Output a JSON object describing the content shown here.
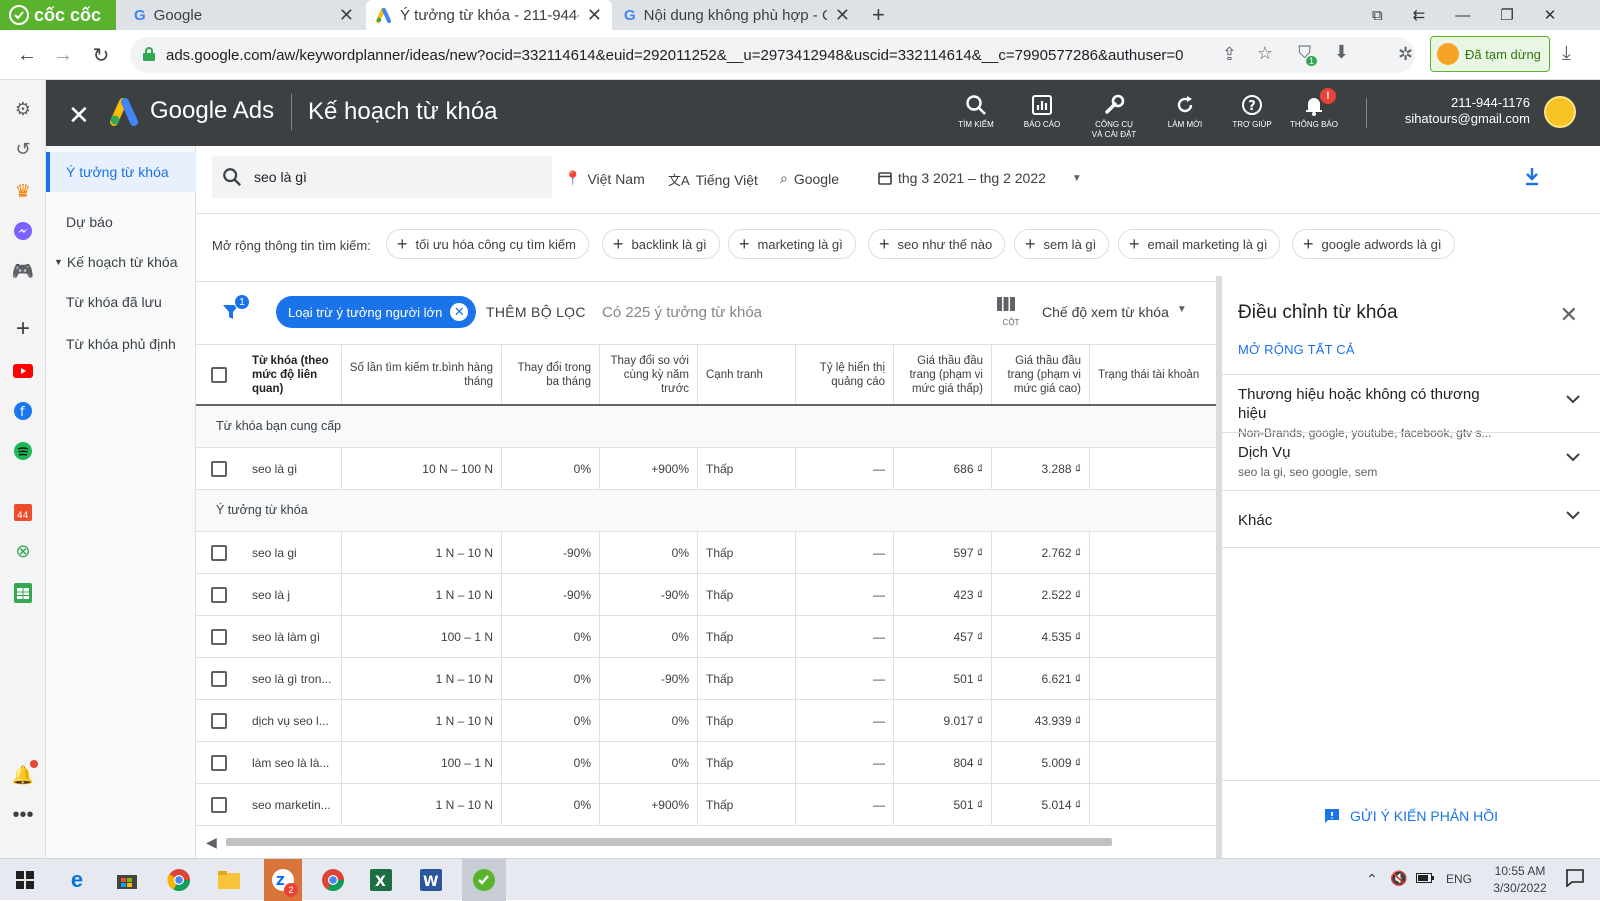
{
  "browser": {
    "brand": "cốc cốc",
    "tabs": [
      {
        "title": "Google",
        "icon": "google-icon"
      },
      {
        "title": "Ý tưởng từ khóa - 211-944-1",
        "icon": "google-ads-icon"
      },
      {
        "title": "Nội dung không phù hợp - C",
        "icon": "google-icon"
      }
    ],
    "url": "ads.google.com/aw/keywordplanner/ideas/new?ocid=332114614&euid=292011252&__u=2973412948&uscid=332114614&__c=7990577286&authuser=0",
    "paused_label": "Đã tạm dừng",
    "extension_badge": "1"
  },
  "header": {
    "brand": "Google Ads",
    "title": "Kế hoạch từ khóa",
    "tools": [
      {
        "label": "TÌM KIẾM",
        "icon": "search-icon"
      },
      {
        "label": "BÁO CÁO",
        "icon": "reports-icon"
      },
      {
        "label": "CÔNG CỤ VÀ CÀI ĐẶT",
        "icon": "wrench-icon"
      },
      {
        "label": "LÀM MỚI",
        "icon": "refresh-icon"
      },
      {
        "label": "TRỢ GIÚP",
        "icon": "help-icon"
      },
      {
        "label": "THÔNG BÁO",
        "icon": "bell-icon",
        "badge": "!"
      }
    ],
    "account_id": "211-944-1176",
    "account_email": "sihatours@gmail.com"
  },
  "nav": {
    "items": [
      {
        "label": "Ý tưởng từ khóa",
        "active": true
      },
      {
        "label": "Dự báo"
      },
      {
        "label": "Kế hoạch từ khóa",
        "caret": true
      },
      {
        "label": "Từ khóa đã lưu"
      },
      {
        "label": "Từ khóa phủ định"
      }
    ]
  },
  "toolbar": {
    "query": "seo là gì",
    "location": "Việt Nam",
    "language": "Tiếng Việt",
    "network": "Google",
    "date_range": "thg 3 2021 – thg 2 2022"
  },
  "expand": {
    "label": "Mở rộng thông tin tìm kiếm:",
    "pills": [
      "tối ưu hóa công cụ tìm kiếm",
      "backlink là gì",
      "marketing là gì",
      "seo như thế nào",
      "sem là gì",
      "email marketing là gì",
      "google adwords là gì"
    ]
  },
  "filters": {
    "badge": "1",
    "chip": "Loại trừ ý tưởng người lớn",
    "add_filter": "THÊM BỘ LỌC",
    "count_text": "Có 225 ý tưởng từ khóa",
    "columns_label": "CỘT",
    "view_mode": "Chế độ xem từ khóa"
  },
  "table": {
    "headers": [
      "Từ khóa (theo mức độ liên quan)",
      "Số lần tìm kiếm tr.bình hàng tháng",
      "Thay đổi trong ba tháng",
      "Thay đổi so với cùng kỳ năm trước",
      "Cạnh tranh",
      "Tỷ lệ hiển thị quảng cáo",
      "Giá thầu đầu trang (phạm vi mức giá thấp)",
      "Giá thầu đầu trang (phạm vi mức giá cao)",
      "Trạng thái tài khoản"
    ],
    "group1": "Từ khóa bạn cung cấp",
    "provided": [
      [
        "seo là gì",
        "10 N – 100 N",
        "0%",
        "+900%",
        "Thấp",
        "—",
        "686 ₫",
        "3.288 ₫"
      ]
    ],
    "group2": "Ý tưởng từ khóa",
    "ideas": [
      [
        "seo la gi",
        "1 N – 10 N",
        "-90%",
        "0%",
        "Thấp",
        "—",
        "597 ₫",
        "2.762 ₫"
      ],
      [
        "seo là j",
        "1 N – 10 N",
        "-90%",
        "-90%",
        "Thấp",
        "—",
        "423 ₫",
        "2.522 ₫"
      ],
      [
        "seo là làm gì",
        "100 – 1 N",
        "0%",
        "0%",
        "Thấp",
        "—",
        "457 ₫",
        "4.535 ₫"
      ],
      [
        "seo là gì tron...",
        "1 N – 10 N",
        "0%",
        "-90%",
        "Thấp",
        "—",
        "501 ₫",
        "6.621 ₫"
      ],
      [
        "dịch vụ seo l...",
        "1 N – 10 N",
        "0%",
        "0%",
        "Thấp",
        "—",
        "9.017 ₫",
        "43.939 ₫"
      ],
      [
        "làm seo là là...",
        "100 – 1 N",
        "0%",
        "0%",
        "Thấp",
        "—",
        "804 ₫",
        "5.009 ₫"
      ],
      [
        "seo marketin...",
        "1 N – 10 N",
        "0%",
        "+900%",
        "Thấp",
        "—",
        "501 ₫",
        "5.014 ₫"
      ]
    ]
  },
  "panel": {
    "title": "Điều chỉnh từ khóa",
    "expand_all": "MỞ RỘNG TẤT CẢ",
    "groups": [
      {
        "title": "Thương hiệu hoặc không có thương hiệu",
        "sub": "Non-Brands, google, youtube, facebook, gtv s..."
      },
      {
        "title": "Dịch Vụ",
        "sub": "seo la gi, seo google, sem"
      },
      {
        "title": "Khác",
        "sub": ""
      }
    ],
    "feedback": "GỬI Ý KIẾN PHẢN HỒI"
  },
  "taskbar": {
    "lang": "ENG",
    "time": "10:55 AM",
    "date": "3/30/2022",
    "badge_count": "2"
  },
  "colors": {
    "accent": "#1a73e8",
    "header": "#3c4043",
    "coccoc": "#59b32d"
  }
}
